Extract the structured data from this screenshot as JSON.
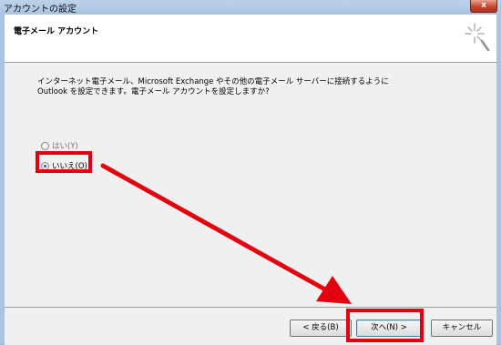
{
  "window": {
    "title": "アカウントの設定",
    "close_label": "x"
  },
  "header": {
    "title": "電子メール アカウント"
  },
  "content": {
    "description_line1": "インターネット電子メール、Microsoft Exchange やその他の電子メール サーバーに接続するように",
    "description_line2": "Outlook を設定できます。電子メール アカウントを設定しますか?",
    "options": [
      {
        "label": "はい(Y)",
        "selected": false
      },
      {
        "label": "いいえ(O)",
        "selected": true
      }
    ]
  },
  "buttons": {
    "back": "< 戻る(B)",
    "next": "次へ(N) >",
    "cancel": "キャンセル"
  },
  "colors": {
    "highlight": "#e3000f",
    "arrow": "#e3000f"
  }
}
